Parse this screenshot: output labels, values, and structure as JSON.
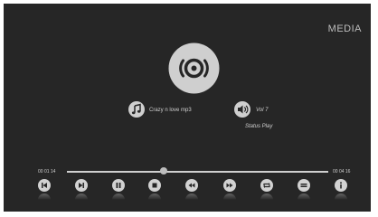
{
  "header": {
    "title": "MEDIA"
  },
  "player": {
    "track_name": "Crazy  n love mp3",
    "volume_label": "Vol 7",
    "status_label": "Status  Play",
    "current_time": "00 01 14",
    "total_time": "00 04 16",
    "progress_fraction": 0.37
  },
  "icons": {
    "disc": "disc-icon",
    "music": "music-note-icon",
    "volume": "speaker-icon"
  },
  "controls": [
    {
      "name": "skip-previous-button",
      "icon": "skip-previous-icon"
    },
    {
      "name": "skip-next-button",
      "icon": "skip-next-icon"
    },
    {
      "name": "pause-button",
      "icon": "pause-icon"
    },
    {
      "name": "stop-button",
      "icon": "stop-icon"
    },
    {
      "name": "rewind-button",
      "icon": "rewind-icon"
    },
    {
      "name": "fast-forward-button",
      "icon": "fast-forward-icon"
    },
    {
      "name": "repeat-button",
      "icon": "repeat-icon"
    },
    {
      "name": "playlist-button",
      "icon": "list-icon"
    },
    {
      "name": "info-button",
      "icon": "info-icon"
    }
  ],
  "colors": {
    "background": "#262626",
    "icon": "#d2d2d2",
    "text": "#cfcfcf"
  }
}
